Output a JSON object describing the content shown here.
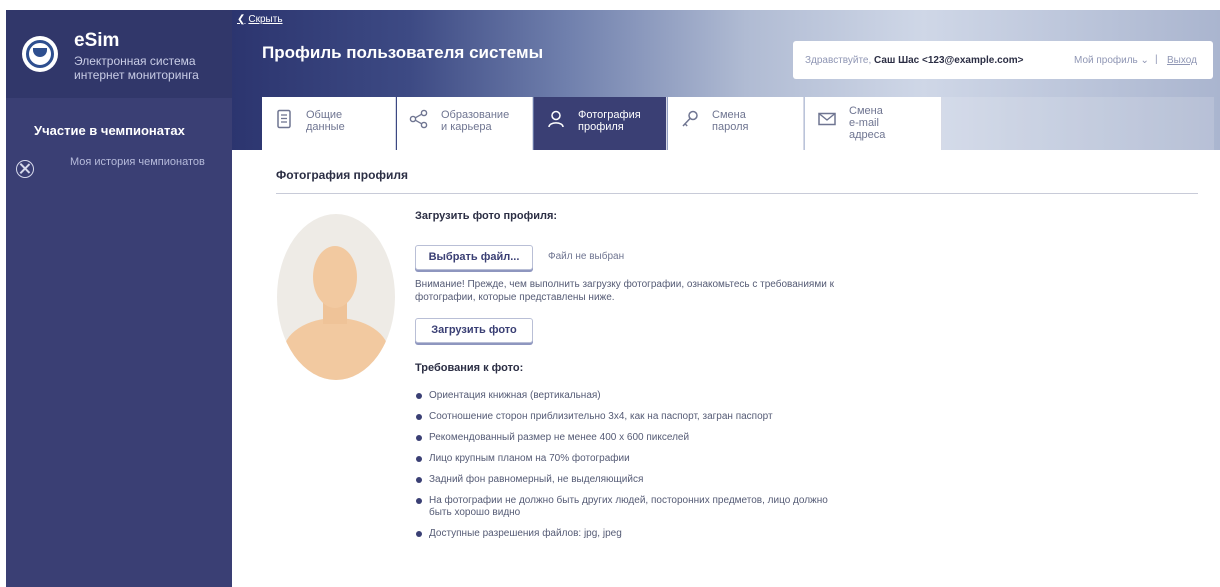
{
  "brand": {
    "name": "eSim",
    "subtitle_line1": "Электронная система",
    "subtitle_line2": "интернет мониторинга"
  },
  "sidebar": {
    "section_title": "Участие в чемпионатах",
    "items": [
      {
        "label": "Моя история чемпионатов",
        "icon": "crossed-circle-icon"
      }
    ]
  },
  "header": {
    "hide_link": "Скрыть",
    "page_title": "Профиль пользователя системы",
    "greeting": "Здравствуйте,",
    "user": "Саш Шас <123@example.com>",
    "my_profile": "Мой профиль",
    "separator": "|",
    "logout": "Выход"
  },
  "tabs": [
    {
      "line1": "Общие",
      "line2": "данные",
      "icon": "document-icon",
      "active": false
    },
    {
      "line1": "Образование",
      "line2": "и карьера",
      "icon": "share-icon",
      "active": false
    },
    {
      "line1": "Фотография",
      "line2": "профиля",
      "icon": "user-icon",
      "active": true
    },
    {
      "line1": "Смена",
      "line2": "пароля",
      "icon": "key-icon",
      "active": false
    },
    {
      "line1": "Смена",
      "line2": "e-mail",
      "line3": "адреса",
      "icon": "envelope-icon",
      "active": false
    }
  ],
  "panel": {
    "title": "Фотография профиля",
    "upload_label": "Загрузить фото профиля:",
    "choose_button": "Выбрать файл...",
    "file_status": "Файл не выбран",
    "warning": "Внимание! Прежде, чем выполнить загрузку фотографии, ознакомьтесь с требованиями к фотографии, которые представлены ниже.",
    "upload_button": "Загрузить фото",
    "requirements_title": "Требования к фото:",
    "requirements": [
      "Ориентация книжная (вертикальная)",
      "Соотношение сторон приблизительно 3х4, как на паспорт, загран паспорт",
      "Рекомендованный размер не менее 400 х 600 пикселей",
      "Лицо крупным планом на 70% фотографии",
      "Задний фон равномерный, не выделяющийся",
      "На фотографии не должно быть других людей, посторонних предметов, лицо должно быть хорошо видно",
      "Доступные разрешения файлов: jpg, jpeg"
    ]
  },
  "colors": {
    "sidebar": "#3a3f74",
    "brand_bg": "#31376a",
    "active_tab": "#3a3f74",
    "bullet": "#3a3f74"
  }
}
